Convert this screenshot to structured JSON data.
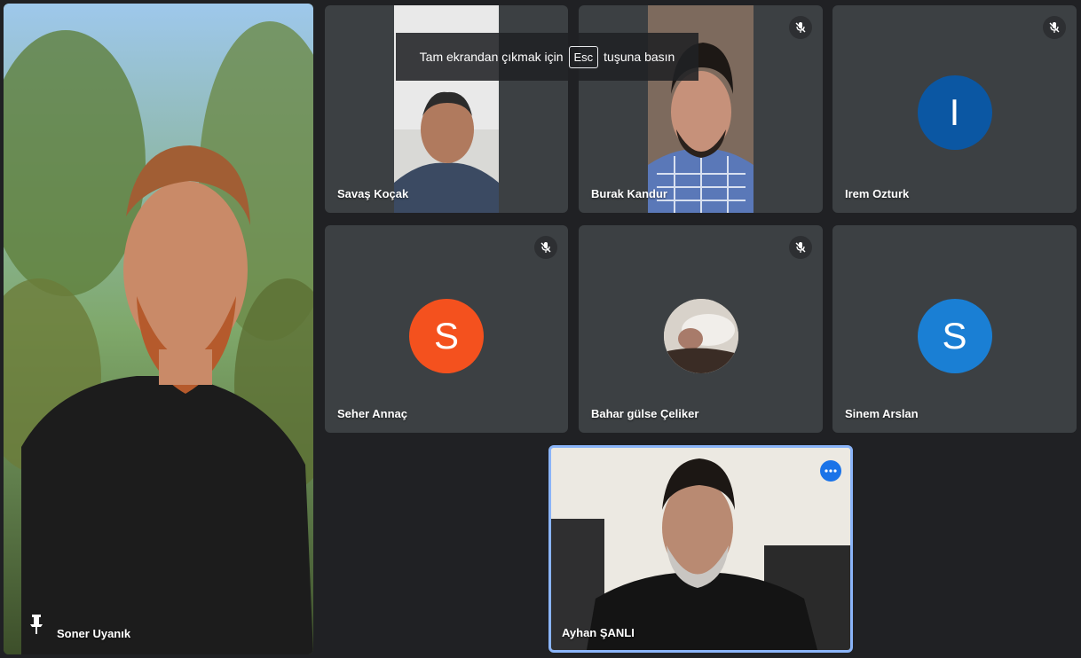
{
  "banner": {
    "text_before": "Tam ekrandan çıkmak için",
    "key": "Esc",
    "text_after": "tuşuna basın"
  },
  "participants": {
    "main": {
      "name": "Soner Uyanık"
    },
    "savas": {
      "name": "Savaş Koçak"
    },
    "burak": {
      "name": "Burak Kandur"
    },
    "irem": {
      "name": "Irem Ozturk",
      "initial": "I",
      "avatar_color": "#0b57a3"
    },
    "seher": {
      "name": "Seher Annaç",
      "initial": "S",
      "avatar_color": "#f4511e"
    },
    "bahar": {
      "name": "Bahar gülse Çeliker"
    },
    "sinem": {
      "name": "Sinem Arslan",
      "initial": "S",
      "avatar_color": "#1a7fd4"
    },
    "ayhan": {
      "name": "Ayhan ŞANLI"
    }
  },
  "icons": {
    "mute": "mic-off-icon",
    "pin": "pin-icon",
    "more": "more-options-icon"
  },
  "colors": {
    "background": "#202124",
    "tile": "#3c4043",
    "accent": "#1a73e8"
  }
}
